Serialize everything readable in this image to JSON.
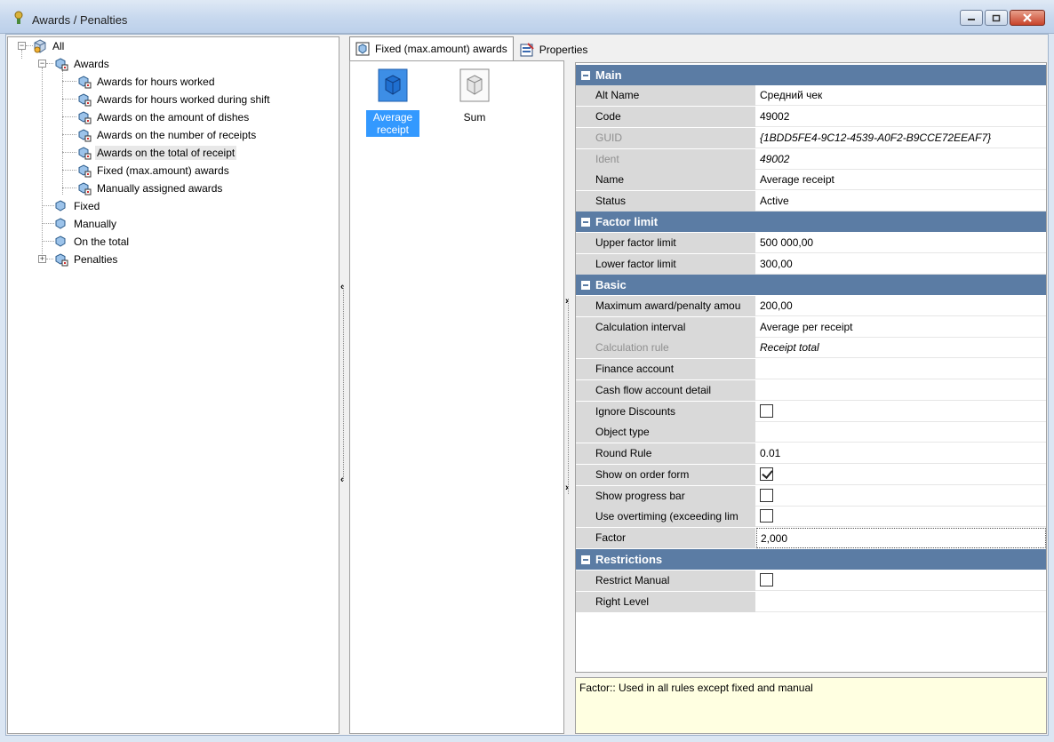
{
  "window": {
    "title": "Awards / Penalties"
  },
  "tree": {
    "root": "All",
    "awards": "Awards",
    "award_items": [
      "Awards for hours worked",
      "Awards for hours worked during shift",
      "Awards on the amount of dishes",
      "Awards on the number of receipts",
      "Awards on the total of receipt",
      "Fixed (max.amount) awards",
      "Manually assigned awards"
    ],
    "fixed": "Fixed",
    "manually": "Manually",
    "on_total": "On the total",
    "penalties": "Penalties"
  },
  "tabs": {
    "items_tab": "Fixed (max.amount) awards",
    "properties_tab": "Properties"
  },
  "items": {
    "average_receipt": "Average receipt",
    "sum": "Sum"
  },
  "grid": {
    "categories": {
      "main": "Main",
      "factor_limit": "Factor limit",
      "basic": "Basic",
      "restrictions": "Restrictions"
    },
    "main": {
      "alt_name_label": "Alt Name",
      "alt_name_value": "Средний чек",
      "code_label": "Code",
      "code_value": "49002",
      "guid_label": "GUID",
      "guid_value": "{1BDD5FE4-9C12-4539-A0F2-B9CCE72EEAF7}",
      "ident_label": "Ident",
      "ident_value": "49002",
      "name_label": "Name",
      "name_value": "Average receipt",
      "status_label": "Status",
      "status_value": "Active"
    },
    "factor_limit": {
      "upper_label": "Upper factor limit",
      "upper_value": "500 000,00",
      "lower_label": "Lower factor limit",
      "lower_value": "300,00"
    },
    "basic": {
      "max_amount_label": "Maximum award/penalty amou",
      "max_amount_value": "200,00",
      "calc_interval_label": "Calculation interval",
      "calc_interval_value": "Average per receipt",
      "calc_rule_label": "Calculation rule",
      "calc_rule_value": "Receipt total",
      "finance_account_label": "Finance account",
      "finance_account_value": "",
      "cash_flow_label": "Cash flow account detail",
      "cash_flow_value": "",
      "ignore_discounts_label": "Ignore Discounts",
      "ignore_discounts_checked": false,
      "object_type_label": "Object type",
      "object_type_value": "",
      "round_rule_label": "Round Rule",
      "round_rule_value": "0.01",
      "show_on_order_label": "Show on order form",
      "show_on_order_checked": true,
      "show_progress_label": "Show progress bar",
      "show_progress_checked": false,
      "use_overtiming_label": "Use overtiming (exceeding lim",
      "use_overtiming_checked": false,
      "factor_label": "Factor",
      "factor_value": "2,000"
    },
    "restrictions": {
      "restrict_manual_label": "Restrict Manual",
      "restrict_manual_checked": false,
      "right_level_label": "Right Level",
      "right_level_value": ""
    }
  },
  "description": "Factor:: Used in all rules except fixed and manual"
}
